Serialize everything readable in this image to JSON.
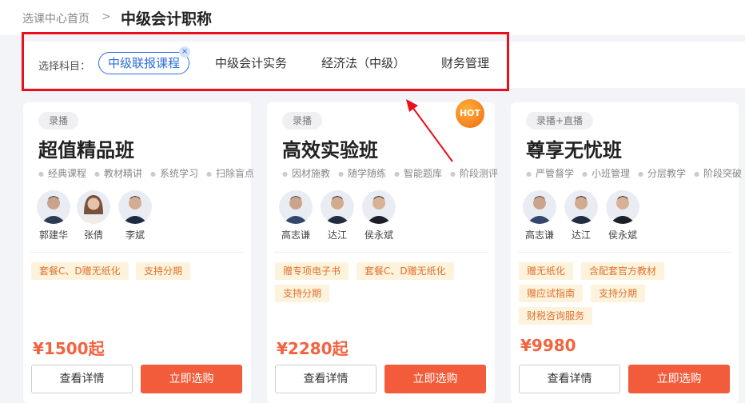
{
  "breadcrumb": {
    "home": "选课中心首页",
    "sep": ">",
    "title": "中级会计职称"
  },
  "filter": {
    "label": "选择科目：",
    "subjects": [
      "中级联报课程",
      "中级会计实务",
      "经济法（中级）",
      "财务管理"
    ],
    "active_close": "×"
  },
  "hot_badge": "HOT",
  "cards": [
    {
      "tag": "录播",
      "title": "超值精品班",
      "features": [
        "经典课程",
        "教材精讲",
        "系统学习",
        "扫除盲点"
      ],
      "teachers": [
        "郭建华",
        "张倩",
        "李斌"
      ],
      "perks": [
        "套餐C、D赠无纸化",
        "支持分期"
      ],
      "price": "¥1500起",
      "detail_label": "查看详情",
      "buy_label": "立即选购"
    },
    {
      "tag": "录播",
      "title": "高效实验班",
      "features": [
        "因材施教",
        "随学随练",
        "智能题库",
        "阶段测评"
      ],
      "teachers": [
        "高志谦",
        "达江",
        "侯永斌"
      ],
      "perks": [
        "赠专项电子书",
        "套餐C、D赠无纸化",
        "支持分期"
      ],
      "price": "¥2280起",
      "detail_label": "查看详情",
      "buy_label": "立即选购"
    },
    {
      "tag": "录播+直播",
      "title": "尊享无忧班",
      "features": [
        "严管督学",
        "小班管理",
        "分层教学",
        "阶段突破"
      ],
      "teachers": [
        "高志谦",
        "达江",
        "侯永斌"
      ],
      "perks": [
        "赠无纸化",
        "含配套官方教材",
        "赠应试指南",
        "支持分期",
        "财税咨询服务"
      ],
      "price": "¥9980",
      "detail_label": "查看详情",
      "buy_label": "立即选购"
    }
  ],
  "colors": {
    "accent": "#2b6fd8",
    "price": "#f2633f",
    "buy": "#f25c3a",
    "highlight": "#e8101a"
  },
  "icons": {
    "avatar": "person-avatar-icon",
    "close": "close-icon",
    "arrow": "red-arrow-annotation"
  }
}
